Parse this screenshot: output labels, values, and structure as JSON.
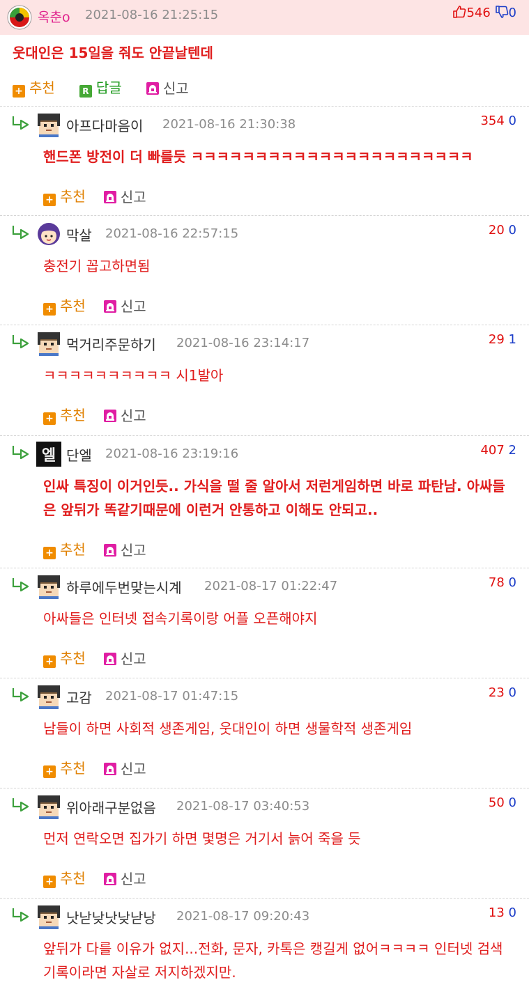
{
  "post": {
    "nick": "옥춘o",
    "date": "2021-08-16 21:25:15",
    "upvotes": "546",
    "downvotes": "0",
    "body": "웃대인은 15일을 줘도 안끝날텐데",
    "actions": {
      "recommend": "추천",
      "reply": "답글",
      "report": "신고"
    }
  },
  "comment_actions": {
    "recommend": "추천",
    "report": "신고"
  },
  "comments": [
    {
      "nick": "아프다마음이",
      "date": "2021-08-16 21:30:38",
      "up": "354",
      "down": "0",
      "body": "핸드폰 방전이 더 빠를듯 ㅋㅋㅋㅋㅋㅋㅋㅋㅋㅋㅋㅋㅋㅋㅋㅋㅋㅋㅋㅋㅋㅋ",
      "avatar": "pixel-face-icon"
    },
    {
      "nick": "막살",
      "date": "2021-08-16 22:57:15",
      "up": "20",
      "down": "0",
      "body": "충전기 꼽고하면됨",
      "avatar": "girl-face-icon"
    },
    {
      "nick": "먹거리주문하기",
      "date": "2021-08-16 23:14:17",
      "up": "29",
      "down": "1",
      "body": "ㅋㅋㅋㅋㅋㅋㅋㅋㅋㅋ 시1발아",
      "avatar": "pixel-face-icon"
    },
    {
      "nick": "단엘",
      "date": "2021-08-16 23:19:16",
      "up": "407",
      "down": "2",
      "body": "인싸 특징이 이거인듯.. 가식을 떨 줄 알아서 저런게임하면 바로 파탄남. 아싸들은 앞뒤가 똑같기때문에 이런거 안통하고 이해도 안되고..",
      "avatar": "el-text-icon"
    },
    {
      "nick": "하루에두번맞는시계",
      "date": "2021-08-17 01:22:47",
      "up": "78",
      "down": "0",
      "body": "아싸들은 인터넷 접속기록이랑 어플 오픈해야지",
      "avatar": "pixel-face-icon"
    },
    {
      "nick": "고감",
      "date": "2021-08-17 01:47:15",
      "up": "23",
      "down": "0",
      "body": "남들이 하면 사회적 생존게임, 웃대인이 하면 생물학적 생존게임",
      "avatar": "pixel-face-icon"
    },
    {
      "nick": "위아래구분없음",
      "date": "2021-08-17 03:40:53",
      "up": "50",
      "down": "0",
      "body": "먼저 연락오면 집가기 하면 몇명은 거기서 늙어 죽을 듯",
      "avatar": "pixel-face-icon"
    },
    {
      "nick": "낫낟낮낫낮낟낭",
      "date": "2021-08-17 09:20:43",
      "up": "13",
      "down": "0",
      "body": "앞뒤가 다를 이유가 없지...전화, 문자, 카톡은 캥길게 없어ㅋㅋㅋㅋ 인터넷 검색 기록이라면 자살로 저지하겠지만.",
      "avatar": "pixel-face-icon"
    }
  ],
  "colors": {
    "header_bg": "#fde4e4",
    "nick_pink": "#e0208c",
    "body_red": "#e01d1d",
    "vote_up": "#e01010",
    "vote_down": "#1a3cc8",
    "recommend_orange": "#e08000",
    "reply_green": "#1e9a1e"
  }
}
